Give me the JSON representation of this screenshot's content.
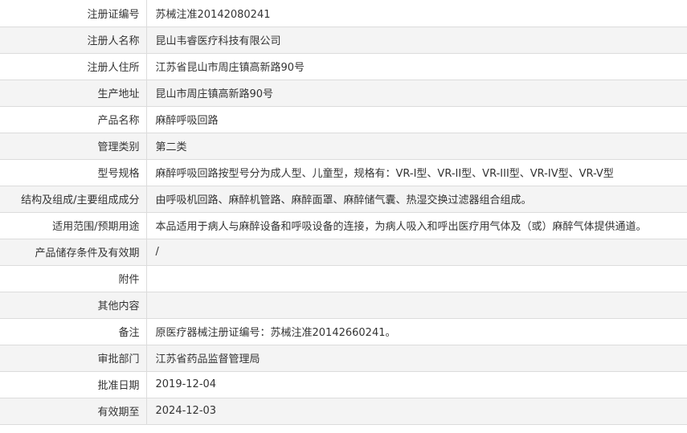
{
  "rows": [
    {
      "label": "注册证编号",
      "value": "苏械注准20142080241"
    },
    {
      "label": "注册人名称",
      "value": "昆山韦睿医疗科技有限公司"
    },
    {
      "label": "注册人住所",
      "value": "江苏省昆山市周庄镇高新路90号"
    },
    {
      "label": "生产地址",
      "value": "昆山市周庄镇高新路90号"
    },
    {
      "label": "产品名称",
      "value": "麻醉呼吸回路"
    },
    {
      "label": "管理类别",
      "value": "第二类"
    },
    {
      "label": "型号规格",
      "value": "麻醉呼吸回路按型号分为成人型、儿童型，规格有：VR-I型、VR-II型、VR-III型、VR-IV型、VR-V型"
    },
    {
      "label": "结构及组成/主要组成成分",
      "value": "由呼吸机回路、麻醉机管路、麻醉面罩、麻醉储气囊、热湿交换过滤器组合组成。"
    },
    {
      "label": "适用范围/预期用途",
      "value": "本品适用于病人与麻醉设备和呼吸设备的连接，为病人吸入和呼出医疗用气体及（或）麻醉气体提供通道。"
    },
    {
      "label": "产品储存条件及有效期",
      "value": "/"
    },
    {
      "label": "附件",
      "value": ""
    },
    {
      "label": "其他内容",
      "value": ""
    },
    {
      "label": "备注",
      "value": "原医疗器械注册证编号：苏械注准20142660241。"
    },
    {
      "label": "审批部门",
      "value": "江苏省药品监督管理局"
    },
    {
      "label": "批准日期",
      "value": "2019-12-04"
    },
    {
      "label": "有效期至",
      "value": "2024-12-03"
    }
  ]
}
